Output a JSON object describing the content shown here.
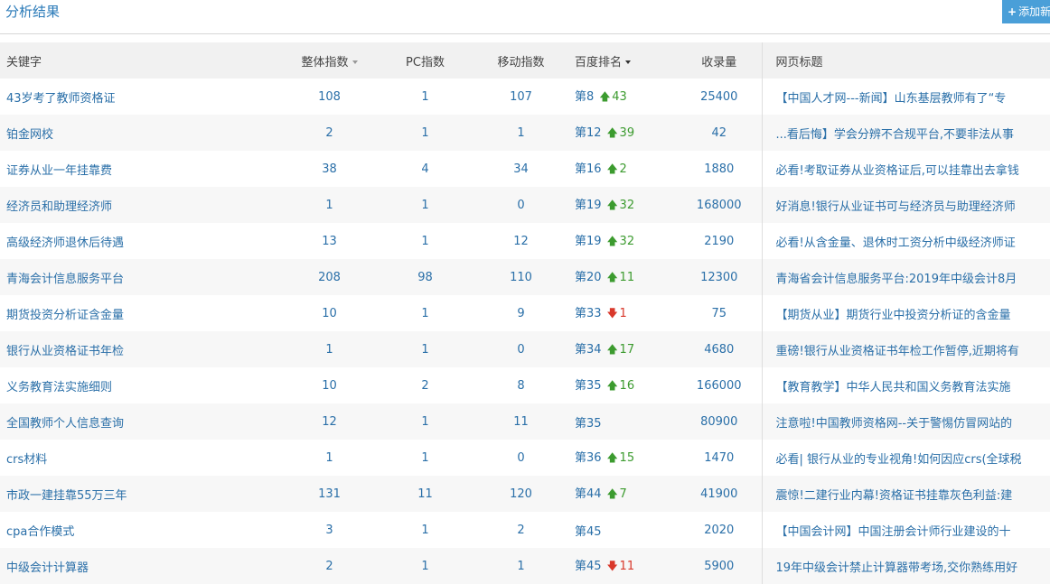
{
  "header": {
    "title": "分析结果",
    "add_button_label": "添加新"
  },
  "table": {
    "columns": {
      "keyword": "关键字",
      "overall_index": "整体指数",
      "pc_index": "PC指数",
      "mobile_index": "移动指数",
      "baidu_rank": "百度排名",
      "indexed_count": "收录量",
      "page_title": "网页标题"
    },
    "rows": [
      {
        "keyword": "43岁考了教师资格证",
        "overall": "108",
        "pc": "1",
        "mobile": "107",
        "rank": "第8",
        "dir": "up",
        "arrow": "🡅",
        "change": "43",
        "indexed": "25400",
        "title": "【中国人才网---新闻】山东基层教师有了“专"
      },
      {
        "keyword": "铂金网校",
        "overall": "2",
        "pc": "1",
        "mobile": "1",
        "rank": "第12",
        "dir": "up",
        "arrow": "🡅",
        "change": "39",
        "indexed": "42",
        "title": "...看后悔】学会分辨不合规平台,不要非法从事"
      },
      {
        "keyword": "证券从业一年挂靠费",
        "overall": "38",
        "pc": "4",
        "mobile": "34",
        "rank": "第16",
        "dir": "up",
        "arrow": "🡅",
        "change": "2",
        "indexed": "1880",
        "title": "必看!考取证券从业资格证后,可以挂靠出去拿钱"
      },
      {
        "keyword": "经济员和助理经济师",
        "overall": "1",
        "pc": "1",
        "mobile": "0",
        "rank": "第19",
        "dir": "up",
        "arrow": "🡅",
        "change": "32",
        "indexed": "168000",
        "title": "好消息!银行从业证书可与经济员与助理经济师"
      },
      {
        "keyword": "高级经济师退休后待遇",
        "overall": "13",
        "pc": "1",
        "mobile": "12",
        "rank": "第19",
        "dir": "up",
        "arrow": "🡅",
        "change": "32",
        "indexed": "2190",
        "title": "必看!从含金量、退休时工资分析中级经济师证"
      },
      {
        "keyword": "青海会计信息服务平台",
        "overall": "208",
        "pc": "98",
        "mobile": "110",
        "rank": "第20",
        "dir": "up",
        "arrow": "🡅",
        "change": "11",
        "indexed": "12300",
        "title": "青海省会计信息服务平台:2019年中级会计8月"
      },
      {
        "keyword": "期货投资分析证含金量",
        "overall": "10",
        "pc": "1",
        "mobile": "9",
        "rank": "第33",
        "dir": "down",
        "arrow": "🡇",
        "change": "1",
        "indexed": "75",
        "title": "【期货从业】期货行业中投资分析证的含金量"
      },
      {
        "keyword": "银行从业资格证书年检",
        "overall": "1",
        "pc": "1",
        "mobile": "0",
        "rank": "第34",
        "dir": "up",
        "arrow": "🡅",
        "change": "17",
        "indexed": "4680",
        "title": "重磅!银行从业资格证书年检工作暂停,近期将有"
      },
      {
        "keyword": "义务教育法实施细则",
        "overall": "10",
        "pc": "2",
        "mobile": "8",
        "rank": "第35",
        "dir": "up",
        "arrow": "🡅",
        "change": "16",
        "indexed": "166000",
        "title": "【教育教学】中华人民共和国义务教育法实施"
      },
      {
        "keyword": "全国教师个人信息查询",
        "overall": "12",
        "pc": "1",
        "mobile": "11",
        "rank": "第35",
        "dir": "none",
        "arrow": "",
        "change": "",
        "indexed": "80900",
        "title": "注意啦!中国教师资格网--关于警惕仿冒网站的"
      },
      {
        "keyword": "crs材料",
        "overall": "1",
        "pc": "1",
        "mobile": "0",
        "rank": "第36",
        "dir": "up",
        "arrow": "🡅",
        "change": "15",
        "indexed": "1470",
        "title": "必看| 银行从业的专业视角!如何因应crs(全球税"
      },
      {
        "keyword": "市政一建挂靠55万三年",
        "overall": "131",
        "pc": "11",
        "mobile": "120",
        "rank": "第44",
        "dir": "up",
        "arrow": "🡅",
        "change": "7",
        "indexed": "41900",
        "title": "震惊!二建行业内幕!资格证书挂靠灰色利益:建"
      },
      {
        "keyword": "cpa合作模式",
        "overall": "3",
        "pc": "1",
        "mobile": "2",
        "rank": "第45",
        "dir": "none",
        "arrow": "",
        "change": "",
        "indexed": "2020",
        "title": "【中国会计网】中国注册会计师行业建设的十"
      },
      {
        "keyword": "中级会计计算器",
        "overall": "2",
        "pc": "1",
        "mobile": "1",
        "rank": "第45",
        "dir": "down",
        "arrow": "🡇",
        "change": "11",
        "indexed": "5900",
        "title": "19年中级会计禁止计算器带考场,交你熟练用好"
      }
    ]
  }
}
